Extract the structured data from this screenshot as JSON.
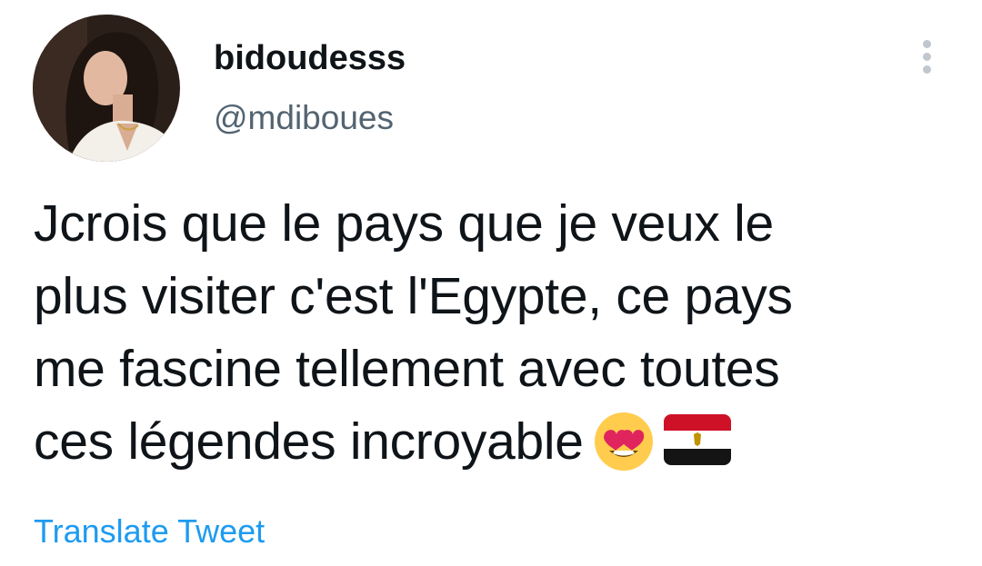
{
  "author": {
    "display_name": "bidoudesss",
    "handle": "@mdiboues",
    "avatar_icon": "profile-photo"
  },
  "menu": {
    "icon": "more-options-vertical-icon"
  },
  "tweet": {
    "lines": [
      "Jcrois que le pays que je veux le",
      "plus visiter c'est l'Egypte, ce pays",
      "me fascine tellement avec toutes",
      "ces légendes incroyable"
    ],
    "emojis": [
      "heart-eyes-emoji-icon",
      "egypt-flag-emoji-icon"
    ]
  },
  "translate_label": "Translate Tweet",
  "colors": {
    "text": "#0f1419",
    "secondary": "#536471",
    "link": "#1d9bf0",
    "background": "#ffffff"
  }
}
